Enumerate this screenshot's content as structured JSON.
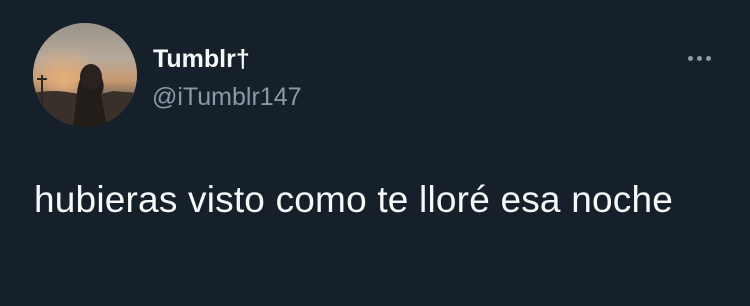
{
  "tweet": {
    "author": {
      "display_name": "Tumblr†",
      "handle": "@iTumblr147",
      "avatar_icon": "profile-photo-sunset-silhouette"
    },
    "text": "hubieras visto como te lloré esa noche",
    "more_icon": "more-horizontal-icon"
  },
  "colors": {
    "background": "#15202b",
    "primary_text": "#f7f9f9",
    "secondary_text": "#8b98a5"
  }
}
